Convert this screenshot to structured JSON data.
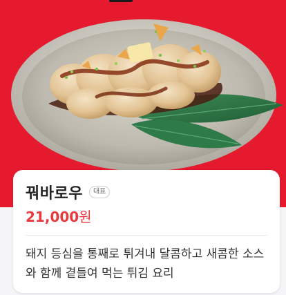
{
  "hero": {
    "image_description": "fried-pork-dish-on-silver-plate-with-bamboo-leaves",
    "background_color": "#e61a2e"
  },
  "menu": {
    "name": "꿔바로우",
    "badge": "대표",
    "price": "21,000",
    "currency": "원",
    "description": "돼지 등심을 통째로 튀겨내 달콤하고 새콤한 소스와 함께 곁들여 먹는 튀김 요리",
    "price_color": "#e8393d"
  }
}
